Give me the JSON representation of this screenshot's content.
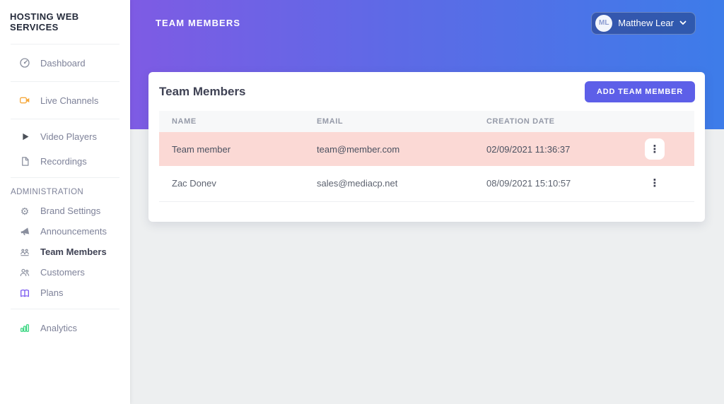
{
  "sidebar": {
    "brand": "HOSTING WEB SERVICES",
    "items": [
      {
        "label": "Dashboard",
        "icon": "dashboard-icon"
      },
      {
        "label": "Live Channels",
        "icon": "video-camera-icon"
      },
      {
        "label": "Video Players",
        "icon": "play-icon"
      },
      {
        "label": "Recordings",
        "icon": "file-icon"
      }
    ],
    "admin_section": {
      "label": "ADMINISTRATION",
      "items": [
        {
          "label": "Brand Settings",
          "icon": "gear-icon"
        },
        {
          "label": "Announcements",
          "icon": "megaphone-icon"
        },
        {
          "label": "Team Members",
          "icon": "team-icon",
          "active": true
        },
        {
          "label": "Customers",
          "icon": "customers-icon"
        },
        {
          "label": "Plans",
          "icon": "book-icon"
        }
      ]
    },
    "footer_items": [
      {
        "label": "Analytics",
        "icon": "bar-chart-icon"
      }
    ]
  },
  "header": {
    "title": "TEAM MEMBERS",
    "user": {
      "initials": "ML",
      "name": "Matthew Lear"
    }
  },
  "card": {
    "title": "Team Members",
    "add_button_label": "ADD TEAM MEMBER",
    "table": {
      "columns": [
        "NAME",
        "EMAIL",
        "CREATION DATE"
      ],
      "rows": [
        {
          "name": "Team member",
          "email": "team@member.com",
          "creation_date": "02/09/2021 11:36:37",
          "highlighted": true
        },
        {
          "name": "Zac Donev",
          "email": "sales@mediacp.net",
          "creation_date": "08/09/2021 15:10:57",
          "highlighted": false
        }
      ]
    }
  },
  "icons": {
    "dots_menu": "⋮",
    "gear": "⚙"
  },
  "colors": {
    "accent_button": "#5d5fe8",
    "gradient_left": "#7e5be4",
    "gradient_right": "#3d7ce9",
    "highlight_row": "#fbd9d5",
    "live_channels_icon": "#f5a83c",
    "plans_icon": "#7c5cf0",
    "analytics_icon": "#2ed47a"
  }
}
